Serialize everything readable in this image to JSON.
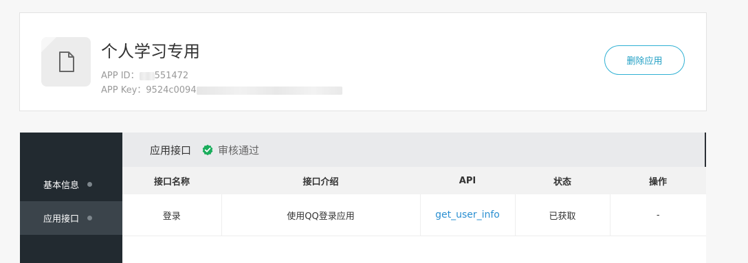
{
  "app": {
    "name": "个人学习专用",
    "id_label": "APP ID：",
    "id_value_visible": "551472",
    "key_label": "APP Key：",
    "key_value_visible": "9524c0094",
    "delete_label": "删除应用"
  },
  "sidebar": {
    "items": [
      {
        "label": "基本信息"
      },
      {
        "label": "应用接口"
      }
    ]
  },
  "section": {
    "title": "应用接口",
    "status": "审核通过"
  },
  "table": {
    "headers": [
      "接口名称",
      "接口介绍",
      "API",
      "状态",
      "操作"
    ],
    "rows": [
      {
        "name": "登录",
        "desc": "使用QQ登录应用",
        "api": "get_user_info",
        "status": "已获取",
        "action": "-"
      }
    ]
  },
  "colors": {
    "accent": "#2eb0d3",
    "success": "#1aad5c",
    "sidebar_bg": "#222a30",
    "link": "#2a8fd1"
  },
  "icons": {
    "app_icon": "file-icon",
    "status_icon": "check-badge-icon"
  }
}
